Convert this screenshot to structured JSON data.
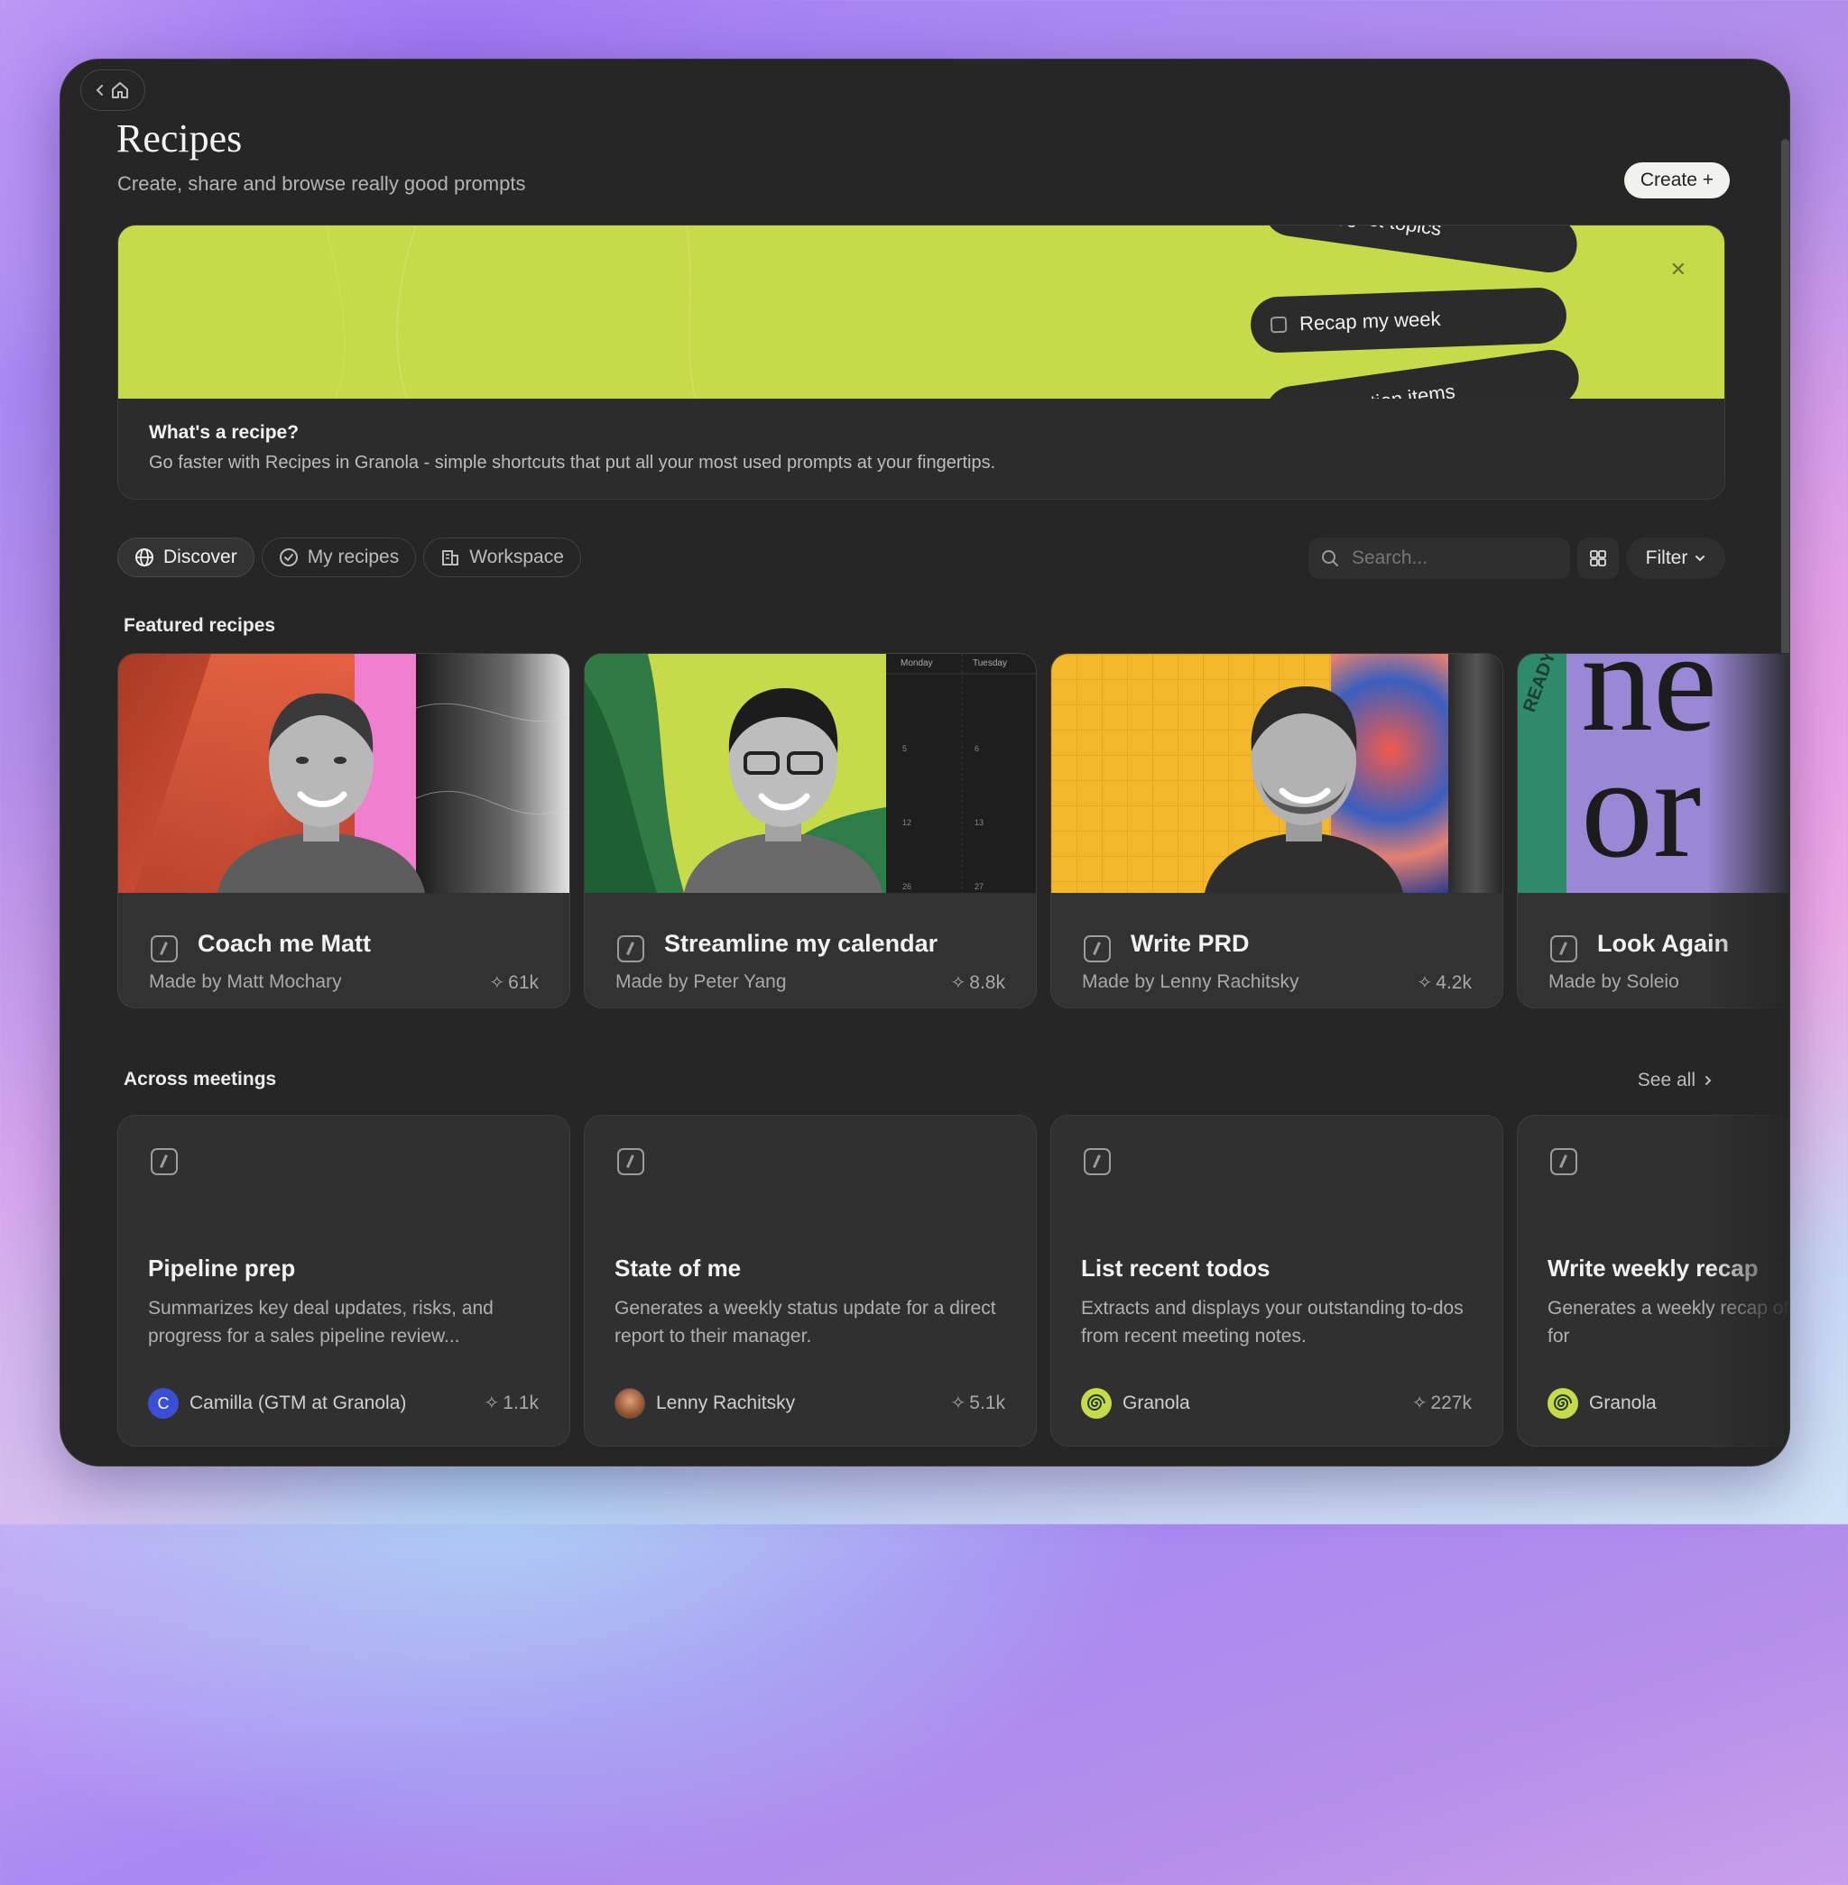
{
  "header": {
    "title": "Recipes",
    "subtitle": "Create, share and browse really good prompts",
    "create_label": "Create +"
  },
  "banner": {
    "pills": [
      "Suggest topics",
      "Recap my week",
      "List action items"
    ],
    "heading": "What's a recipe?",
    "text": "Go faster with Recipes in Granola - simple shortcuts that put all your most used prompts at your fingertips.",
    "accent_color": "#c7da4a"
  },
  "tabs": [
    {
      "label": "Discover",
      "icon": "globe-icon",
      "active": true
    },
    {
      "label": "My recipes",
      "icon": "check-circle-icon",
      "active": false
    },
    {
      "label": "Workspace",
      "icon": "building-icon",
      "active": false
    }
  ],
  "search": {
    "placeholder": "Search..."
  },
  "filter": {
    "label": "Filter"
  },
  "featured": {
    "title": "Featured recipes",
    "cards": [
      {
        "name": "Coach me Matt",
        "author": "Made by Matt Mochary",
        "count": "61k"
      },
      {
        "name": "Streamline my calendar",
        "author": "Made by Peter Yang",
        "count": "8.8k"
      },
      {
        "name": "Write PRD",
        "author": "Made by Lenny Rachitsky",
        "count": "4.2k"
      },
      {
        "name": "Look Again",
        "author": "Made by Soleio",
        "count": ""
      }
    ],
    "calendar_days": [
      "Monday",
      "Tuesday"
    ],
    "calendar_dates": [
      "5",
      "6",
      "12",
      "13",
      "26",
      "27"
    ],
    "poster_text": [
      "READY"
    ]
  },
  "across": {
    "title": "Across meetings",
    "see_all": "See all",
    "cards": [
      {
        "name": "Pipeline prep",
        "desc": "Summarizes key deal updates, risks, and progress for a sales pipeline review...",
        "author": "Camilla (GTM at Granola)",
        "avatar": "C",
        "count": "1.1k"
      },
      {
        "name": "State of me",
        "desc": "Generates a weekly status update for a direct report to their manager.",
        "author": "Lenny Rachitsky",
        "avatar": "",
        "count": "5.1k"
      },
      {
        "name": "List recent todos",
        "desc": "Extracts and displays your outstanding to-dos from recent meeting notes.",
        "author": "Granola",
        "avatar": "",
        "count": "227k"
      },
      {
        "name": "Write weekly recap",
        "desc": "Generates a weekly recap of accomplishments for",
        "author": "Granola",
        "avatar": "",
        "count": ""
      }
    ]
  }
}
